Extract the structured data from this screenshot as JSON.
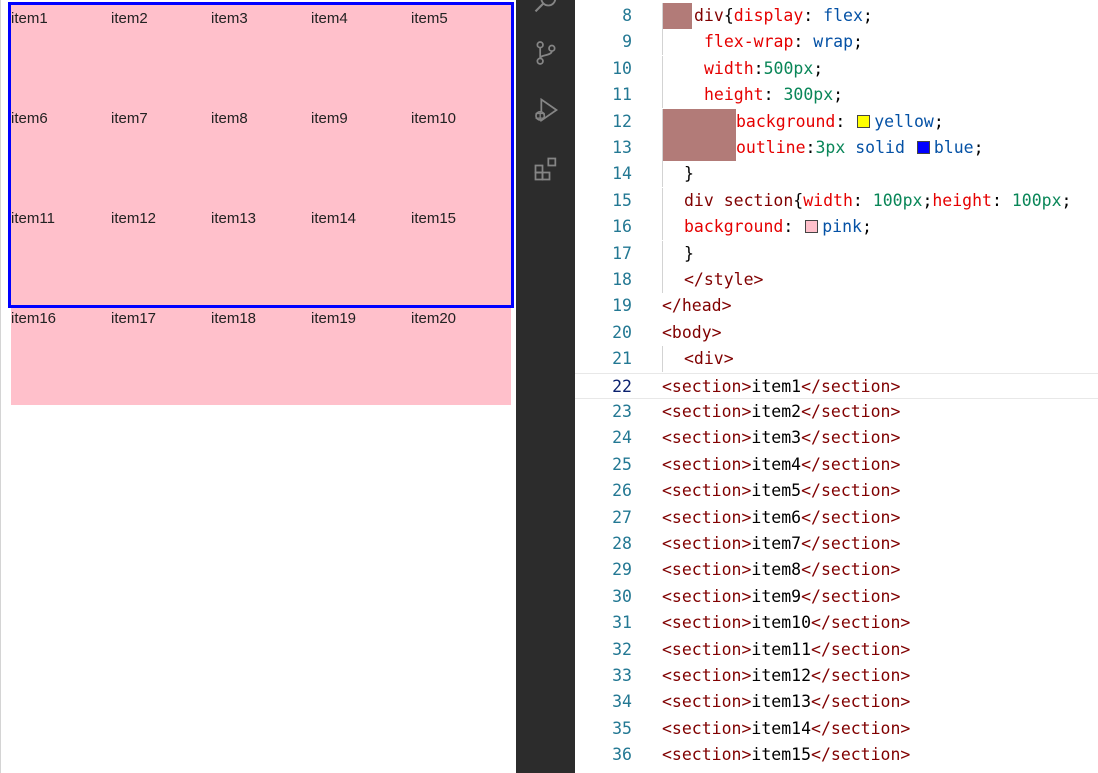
{
  "preview": {
    "items": [
      "item1",
      "item2",
      "item3",
      "item4",
      "item5",
      "item6",
      "item7",
      "item8",
      "item9",
      "item10",
      "item11",
      "item12",
      "item13",
      "item14",
      "item15",
      "item16",
      "item17",
      "item18",
      "item19",
      "item20"
    ],
    "colors": {
      "item_background": "#ffc0cb",
      "outline": "#0000ff"
    }
  },
  "activity_bar": {
    "icons": [
      "search-icon",
      "source-control-icon",
      "run-debug-icon",
      "extensions-icon"
    ]
  },
  "editor": {
    "current_line": "22",
    "lines": [
      {
        "num": "8",
        "parts": [
          [
            "sel",
            "div"
          ],
          [
            "punc",
            "{"
          ],
          [
            "prop",
            "display"
          ],
          [
            "punc",
            ": "
          ],
          [
            "val",
            "flex"
          ],
          [
            "punc",
            ";"
          ]
        ]
      },
      {
        "num": "9",
        "parts": [
          [
            "prop",
            "flex-wrap"
          ],
          [
            "punc",
            ": "
          ],
          [
            "val",
            "wrap"
          ],
          [
            "punc",
            ";"
          ]
        ]
      },
      {
        "num": "10",
        "parts": [
          [
            "prop",
            "width"
          ],
          [
            "punc",
            ":"
          ],
          [
            "num",
            "500px"
          ],
          [
            "punc",
            ";"
          ]
        ]
      },
      {
        "num": "11",
        "parts": [
          [
            "prop",
            "height"
          ],
          [
            "punc",
            ": "
          ],
          [
            "num",
            "300px"
          ],
          [
            "punc",
            ";"
          ]
        ]
      },
      {
        "num": "12",
        "parts": [
          [
            "prop",
            "background"
          ],
          [
            "punc",
            ": "
          ],
          [
            "swatch",
            "#ffff00"
          ],
          [
            "val",
            "yellow"
          ],
          [
            "punc",
            ";"
          ]
        ]
      },
      {
        "num": "13",
        "parts": [
          [
            "prop",
            "outline"
          ],
          [
            "punc",
            ":"
          ],
          [
            "num",
            "3px"
          ],
          [
            "punc",
            " "
          ],
          [
            "val",
            "solid"
          ],
          [
            "punc",
            " "
          ],
          [
            "swatch",
            "#0000ff"
          ],
          [
            "val",
            "blue"
          ],
          [
            "punc",
            ";"
          ]
        ]
      },
      {
        "num": "14",
        "parts": [
          [
            "punc",
            "}"
          ]
        ]
      },
      {
        "num": "15",
        "parts": [
          [
            "sel",
            "div section"
          ],
          [
            "punc",
            "{"
          ],
          [
            "prop",
            "width"
          ],
          [
            "punc",
            ": "
          ],
          [
            "num",
            "100px"
          ],
          [
            "punc",
            ";"
          ],
          [
            "prop",
            "height"
          ],
          [
            "punc",
            ": "
          ],
          [
            "num",
            "100px"
          ],
          [
            "punc",
            ";"
          ]
        ]
      },
      {
        "num": "16",
        "parts": [
          [
            "prop",
            "background"
          ],
          [
            "punc",
            ": "
          ],
          [
            "swatch",
            "#ffc0cb"
          ],
          [
            "val",
            "pink"
          ],
          [
            "punc",
            ";"
          ]
        ]
      },
      {
        "num": "17",
        "parts": [
          [
            "punc",
            "}"
          ]
        ]
      },
      {
        "num": "18",
        "parts": [
          [
            "tag",
            "</style>"
          ]
        ]
      },
      {
        "num": "19",
        "parts": [
          [
            "tag",
            "</head>"
          ]
        ]
      },
      {
        "num": "20",
        "parts": [
          [
            "tag",
            "<body>"
          ]
        ]
      },
      {
        "num": "21",
        "parts": [
          [
            "tag",
            "<div>"
          ]
        ]
      },
      {
        "num": "22",
        "parts": [
          [
            "tag",
            "<section>"
          ],
          [
            "text",
            "item1"
          ],
          [
            "tag",
            "</section>"
          ]
        ]
      },
      {
        "num": "23",
        "parts": [
          [
            "tag",
            "<section>"
          ],
          [
            "text",
            "item2"
          ],
          [
            "tag",
            "</section>"
          ]
        ]
      },
      {
        "num": "24",
        "parts": [
          [
            "tag",
            "<section>"
          ],
          [
            "text",
            "item3"
          ],
          [
            "tag",
            "</section>"
          ]
        ]
      },
      {
        "num": "25",
        "parts": [
          [
            "tag",
            "<section>"
          ],
          [
            "text",
            "item4"
          ],
          [
            "tag",
            "</section>"
          ]
        ]
      },
      {
        "num": "26",
        "parts": [
          [
            "tag",
            "<section>"
          ],
          [
            "text",
            "item5"
          ],
          [
            "tag",
            "</section>"
          ]
        ]
      },
      {
        "num": "27",
        "parts": [
          [
            "tag",
            "<section>"
          ],
          [
            "text",
            "item6"
          ],
          [
            "tag",
            "</section>"
          ]
        ]
      },
      {
        "num": "28",
        "parts": [
          [
            "tag",
            "<section>"
          ],
          [
            "text",
            "item7"
          ],
          [
            "tag",
            "</section>"
          ]
        ]
      },
      {
        "num": "29",
        "parts": [
          [
            "tag",
            "<section>"
          ],
          [
            "text",
            "item8"
          ],
          [
            "tag",
            "</section>"
          ]
        ]
      },
      {
        "num": "30",
        "parts": [
          [
            "tag",
            "<section>"
          ],
          [
            "text",
            "item9"
          ],
          [
            "tag",
            "</section>"
          ]
        ]
      },
      {
        "num": "31",
        "parts": [
          [
            "tag",
            "<section>"
          ],
          [
            "text",
            "item10"
          ],
          [
            "tag",
            "</section>"
          ]
        ]
      },
      {
        "num": "32",
        "parts": [
          [
            "tag",
            "<section>"
          ],
          [
            "text",
            "item11"
          ],
          [
            "tag",
            "</section>"
          ]
        ]
      },
      {
        "num": "33",
        "parts": [
          [
            "tag",
            "<section>"
          ],
          [
            "text",
            "item12"
          ],
          [
            "tag",
            "</section>"
          ]
        ]
      },
      {
        "num": "34",
        "parts": [
          [
            "tag",
            "<section>"
          ],
          [
            "text",
            "item13"
          ],
          [
            "tag",
            "</section>"
          ]
        ]
      },
      {
        "num": "35",
        "parts": [
          [
            "tag",
            "<section>"
          ],
          [
            "text",
            "item14"
          ],
          [
            "tag",
            "</section>"
          ]
        ]
      },
      {
        "num": "36",
        "parts": [
          [
            "tag",
            "<section>"
          ],
          [
            "text",
            "item15"
          ],
          [
            "tag",
            "</section>"
          ]
        ]
      }
    ]
  }
}
